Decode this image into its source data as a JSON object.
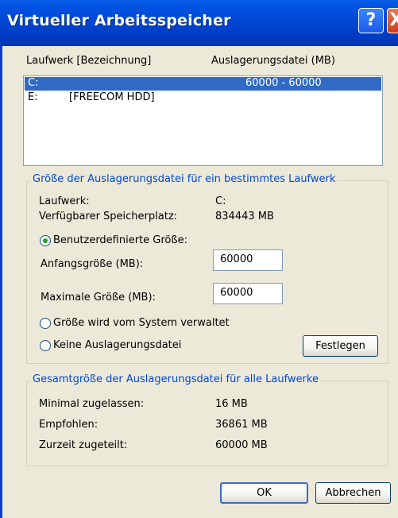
{
  "window": {
    "title": "Virtueller Arbeitsspeicher",
    "help_glyph": "?",
    "close_glyph": "X"
  },
  "list": {
    "headers": {
      "drive": "Laufwerk [Bezeichnung]",
      "pagefile": "Auslagerungsdatei (MB)"
    },
    "rows": [
      {
        "drive": "C:",
        "label": "",
        "size": "60000 - 60000",
        "selected": true
      },
      {
        "drive": "E:",
        "label": "[FREECOM HDD]",
        "size": "",
        "selected": false
      }
    ]
  },
  "drive_group": {
    "legend": "Größe der Auslagerungsdatei für ein bestimmtes Laufwerk",
    "drive_label": "Laufwerk:",
    "drive_value": "C:",
    "space_label": "Verfügbarer Speicherplatz:",
    "space_value": "834443 MB",
    "custom_size": {
      "label": "Benutzerdefinierte Größe:",
      "selected": true
    },
    "initial_label": "Anfangsgröße (MB):",
    "initial_value": "60000",
    "max_label": "Maximale Größe (MB):",
    "max_value": "60000",
    "system_managed": {
      "label": "Größe wird vom System verwaltet",
      "selected": false
    },
    "no_pagefile": {
      "label": "Keine Auslagerungsdatei",
      "selected": false
    },
    "set_button": "Festlegen"
  },
  "total_group": {
    "legend": "Gesamtgröße der Auslagerungsdatei für alle Laufwerke",
    "min_label": "Minimal zugelassen:",
    "min_value": "16 MB",
    "rec_label": "Empfohlen:",
    "rec_value": "36861 MB",
    "cur_label": "Zurzeit zugeteilt:",
    "cur_value": "60000 MB"
  },
  "buttons": {
    "ok": "OK",
    "cancel": "Abbrechen"
  },
  "colors": {
    "titlebar": "#0054e3",
    "selection": "#316ac5",
    "group_legend": "#0046d5",
    "window_bg": "#ece9d8"
  }
}
